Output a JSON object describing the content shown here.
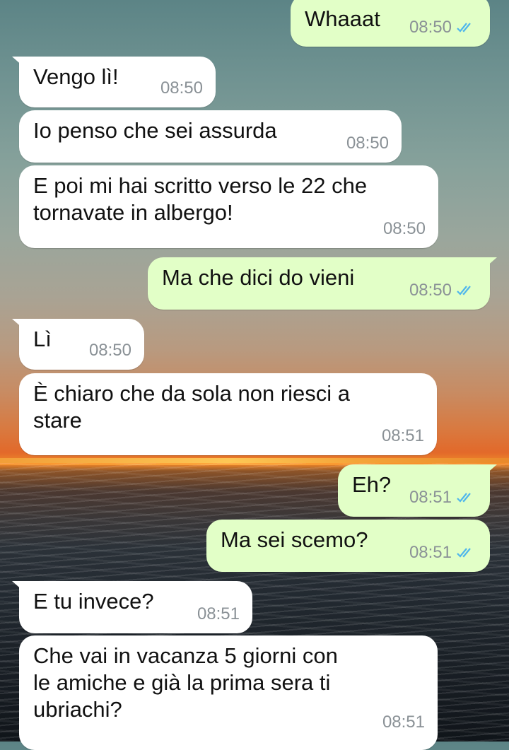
{
  "messages": [
    {
      "dir": "out",
      "text": "Whaaat",
      "time": "08:50",
      "read": true
    },
    {
      "dir": "in",
      "text": "Vengo lì!",
      "time": "08:50"
    },
    {
      "dir": "in",
      "text": "Io penso che sei assurda",
      "time": "08:50"
    },
    {
      "dir": "in",
      "text": "E poi mi hai scritto verso le 22 che\ntornavate in albergo!",
      "time": "08:50"
    },
    {
      "dir": "out",
      "text": "Ma che dici do vieni",
      "time": "08:50",
      "read": true
    },
    {
      "dir": "in",
      "text": "Lì",
      "time": "08:50"
    },
    {
      "dir": "in",
      "text": "È chiaro che da sola non riesci a\nstare",
      "time": "08:51"
    },
    {
      "dir": "out",
      "text": "Eh?",
      "time": "08:51",
      "read": true
    },
    {
      "dir": "out",
      "text": "Ma sei scemo?",
      "time": "08:51",
      "read": true
    },
    {
      "dir": "in",
      "text": "E tu invece?",
      "time": "08:51"
    },
    {
      "dir": "in",
      "text": "Che vai in vacanza 5 giorni con\nle amiche e già la prima sera ti\nubriachi?",
      "time": "08:51"
    }
  ],
  "icons": {
    "read_receipt": "double-check-icon"
  },
  "colors": {
    "incoming_bubble": "#ffffff",
    "outgoing_bubble": "#e2ffc7",
    "read_check": "#4fb6ec",
    "timestamp": "#8a9196"
  }
}
